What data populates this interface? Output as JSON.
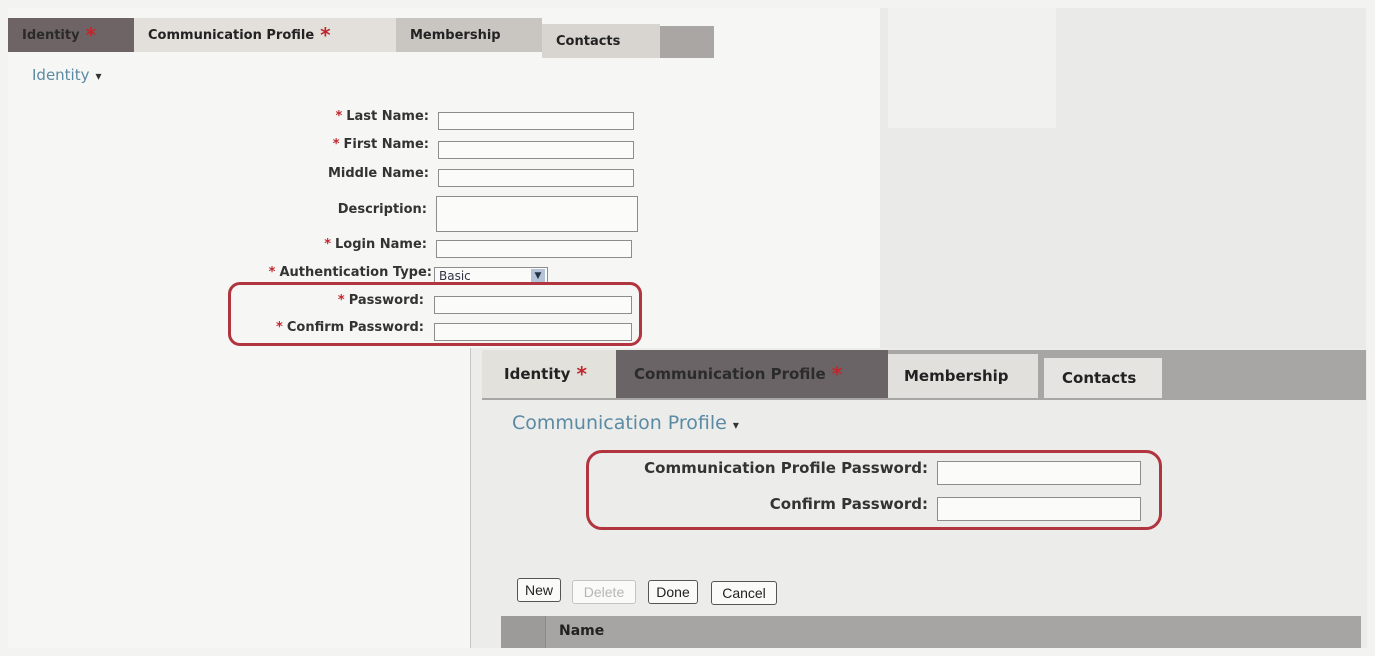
{
  "identity_panel": {
    "tabs": [
      {
        "label": "Identity",
        "required": "*"
      },
      {
        "label": "Communication Profile",
        "required": "*"
      },
      {
        "label": "Membership"
      },
      {
        "label": "Contacts"
      }
    ],
    "section_title": "Identity",
    "section_bullet": "▾",
    "fields": {
      "last_name": "Last Name:",
      "first_name": "First Name:",
      "middle_name": "Middle Name:",
      "description": "Description:",
      "login_name": "Login Name:",
      "auth_type": "Authentication Type:",
      "auth_type_value": "Basic",
      "password": "Password:",
      "confirm_password": "Confirm Password:",
      "required_mark": "*"
    }
  },
  "comm_panel": {
    "tabs": [
      {
        "label": "Identity",
        "required": "*"
      },
      {
        "label": "Communication Profile",
        "required": "*"
      },
      {
        "label": "Membership"
      },
      {
        "label": "Contacts"
      }
    ],
    "section_title": "Communication Profile",
    "section_bullet": "▾",
    "fields": {
      "comm_password": "Communication Profile Password:",
      "confirm_password": "Confirm Password:"
    },
    "buttons": {
      "new": "New",
      "delete": "Delete",
      "done": "Done",
      "cancel": "Cancel"
    },
    "table": {
      "columns": [
        "Name"
      ]
    }
  }
}
